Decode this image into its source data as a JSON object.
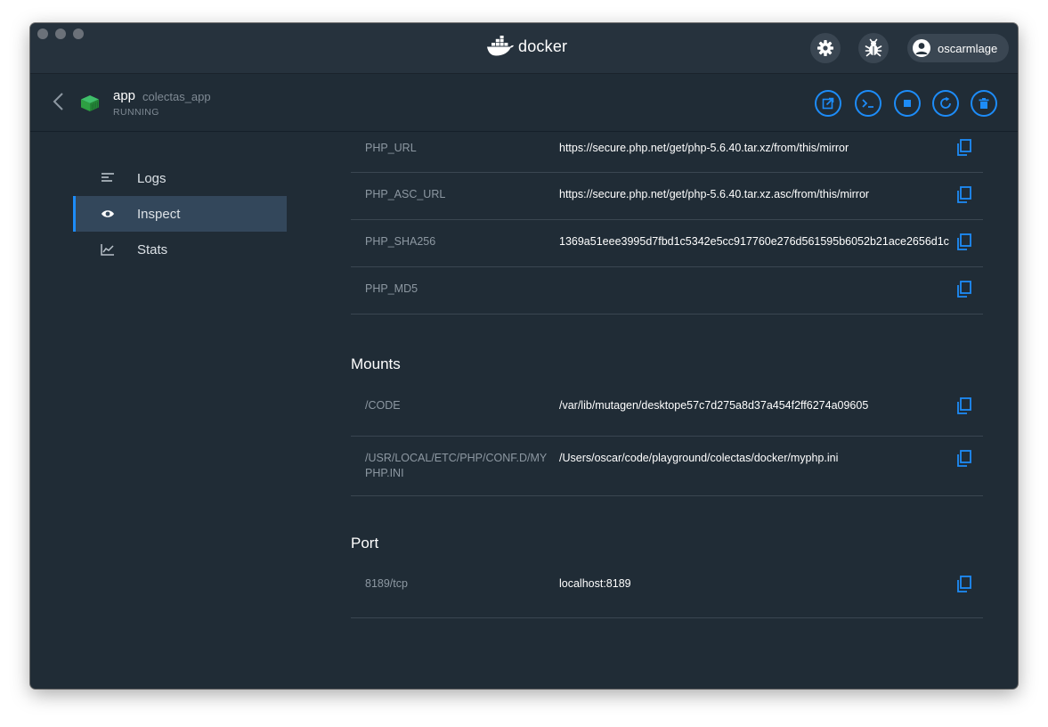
{
  "app": {
    "brand_name": "docker",
    "user": {
      "name": "oscarmlage"
    }
  },
  "container": {
    "name": "app",
    "project": "colectas_app",
    "status": "RUNNING"
  },
  "sidebar": {
    "items": [
      {
        "label": "Logs",
        "icon": "logs-icon",
        "active": false
      },
      {
        "label": "Inspect",
        "icon": "eye-icon",
        "active": true
      },
      {
        "label": "Stats",
        "icon": "chart-icon",
        "active": false
      }
    ]
  },
  "env_rows": [
    {
      "key": "PHP_URL",
      "value": "https://secure.php.net/get/php-5.6.40.tar.xz/from/this/mirror"
    },
    {
      "key": "PHP_ASC_URL",
      "value": "https://secure.php.net/get/php-5.6.40.tar.xz.asc/from/this/mirror"
    },
    {
      "key": "PHP_SHA256",
      "value": "1369a51eee3995d7fbd1c5342e5cc917760e276d561595b6052b21ace2656d1c"
    },
    {
      "key": "PHP_MD5",
      "value": ""
    }
  ],
  "mounts": {
    "title": "Mounts",
    "rows": [
      {
        "key": "/CODE",
        "value": "/var/lib/mutagen/desktope57c7d275a8d37a454f2ff6274a09605"
      },
      {
        "key": "/USR/LOCAL/ETC/PHP/CONF.D/MYPHP.INI",
        "value": "/Users/oscar/code/playground/colectas/docker/myphp.ini"
      }
    ]
  },
  "port": {
    "title": "Port",
    "rows": [
      {
        "key": "8189/tcp",
        "value": "localhost:8189"
      }
    ]
  },
  "colors": {
    "accent": "#1d8cf8",
    "background": "#202c36",
    "container_green": "#2ea043"
  }
}
